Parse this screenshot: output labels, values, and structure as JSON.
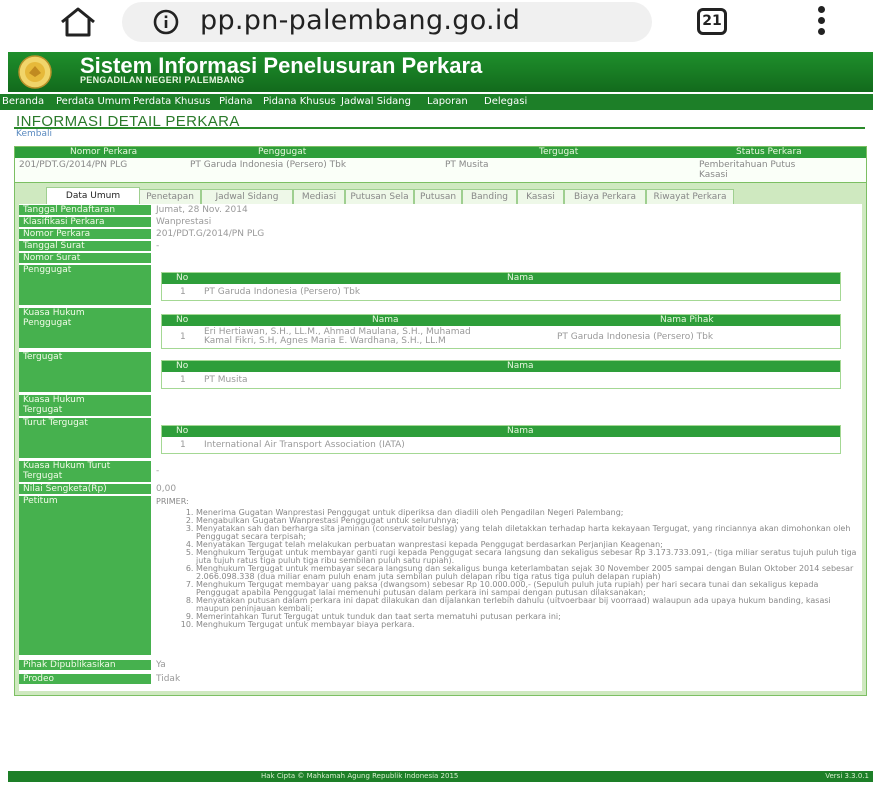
{
  "browser": {
    "url": "pp.pn-palembang.go.id",
    "tabs_count": "21"
  },
  "site": {
    "title": "Sistem Informasi Penelusuran Perkara",
    "subtitle": "PENGADILAN NEGERI PALEMBANG"
  },
  "nav": [
    "Beranda",
    "Perdata Umum",
    "Perdata Khusus",
    "Pidana",
    "Pidana Khusus",
    "Jadwal Sidang",
    "Laporan",
    "Delegasi"
  ],
  "page": {
    "title": "INFORMASI DETAIL PERKARA",
    "back": "Kembali"
  },
  "summary": {
    "headers": [
      "Nomor Perkara",
      "Penggugat",
      "Tergugat",
      "Status Perkara"
    ],
    "row": [
      "201/PDT.G/2014/PN PLG",
      "PT Garuda Indonesia (Persero) Tbk",
      "PT Musita",
      "Pemberitahuan Putus",
      "Kasasi"
    ]
  },
  "tabs": [
    "Data Umum",
    "Penetapan",
    "Jadwal Sidang",
    "Mediasi",
    "Putusan Sela",
    "Putusan",
    "Banding",
    "Kasasi",
    "Biaya Perkara",
    "Riwayat Perkara"
  ],
  "fields": {
    "tanggal_pendaftaran": {
      "label": "Tanggal Pendaftaran",
      "value": "Jumat, 28 Nov. 2014"
    },
    "klasifikasi": {
      "label": "Klasifikasi Perkara",
      "value": "Wanprestasi"
    },
    "nomor_perkara": {
      "label": "Nomor Perkara",
      "value": "201/PDT.G/2014/PN PLG"
    },
    "tanggal_surat": {
      "label": "Tanggal Surat",
      "value": "-"
    },
    "nomor_surat": {
      "label": "Nomor Surat",
      "value": ""
    },
    "penggugat": {
      "label": "Penggugat",
      "col_no": "No",
      "col_nama": "Nama",
      "no": "1",
      "nama": "PT Garuda Indonesia (Persero) Tbk"
    },
    "kuasa_penggugat": {
      "label1": "Kuasa Hukum",
      "label2": "Penggugat",
      "col_no": "No",
      "col_nama": "Nama",
      "col_pihak": "Nama Pihak",
      "no": "1",
      "nama1": "Eri Hertiawan, S.H., LL.M., Ahmad Maulana, S.H., Muhamad",
      "nama2": "Kamal Fikri, S.H, Agnes Maria E. Wardhana, S.H., LL.M",
      "pihak": "PT Garuda Indonesia (Persero) Tbk"
    },
    "tergugat": {
      "label": "Tergugat",
      "col_no": "No",
      "col_nama": "Nama",
      "no": "1",
      "nama": "PT Musita"
    },
    "kuasa_tergugat": {
      "label1": "Kuasa Hukum",
      "label2": "Tergugat"
    },
    "turut_tergugat": {
      "label": "Turut Tergugat",
      "col_no": "No",
      "col_nama": "Nama",
      "no": "1",
      "nama": "International Air Transport Association (IATA)"
    },
    "kuasa_turut": {
      "label1": "Kuasa Hukum Turut",
      "label2": "Tergugat",
      "value": "-"
    },
    "nilai_sengketa": {
      "label": "Nilai Sengketa(Rp)",
      "value": "0,00"
    },
    "petitum": {
      "label": "Petitum",
      "heading": "PRIMER:"
    },
    "dipublikasikan": {
      "label": "Pihak Dipublikasikan",
      "value": "Ya"
    },
    "prodeo": {
      "label": "Prodeo",
      "value": "Tidak"
    }
  },
  "petitum_items": [
    "Menerima Gugatan Wanprestasi Penggugat untuk diperiksa dan diadili oleh Pengadilan Negeri Palembang;",
    "Mengabulkan Gugatan Wanprestasi Penggugat untuk seluruhnya;",
    "Menyatakan sah dan berharga sita jaminan (conservatoir beslag) yang telah diletakkan terhadap harta kekayaan Tergugat, yang rincian­nya akan dimohonkan oleh Penggugat secara terpisah;",
    "Menyatakan Tergugat telah melakukan perbuatan wanprestasi kepada Penggugat berdasarkan Perjanjian Keagenan;",
    "Menghukum Tergugat untuk membayar ganti rugi kepada Penggugat secara langsung dan sekaligus sebesar Rp 3.173.733.091,- (tiga miliar seratus tujuh puluh tiga juta tujuh ratus tiga puluh tiga ribu sembilan puluh satu rupiah).",
    "Menghukum Tergugat untuk membayar secara langsung dan sekaligus bunga keterlambatan sejak 30 November 2005 sampai dengan Bulan Oktober 2014 sebesar 2.066.098.338 (dua miliar enam puluh enam juta sembilan puluh delapan ribu tiga ratus tiga puluh delapan rupiah)",
    "Menghukum Tergugat membayar uang paksa (dwangsom) sebesar Rp 10.000.000,- (Sepuluh puluh juta rupiah) per hari secara tunai dan sekaligus kepada Penggugat apabila Penggugat lalai memenuhi putusan dalam perkara ini sampai dengan putusan dilaksanakan;",
    "Menyatakan putusan dalam perkara ini dapat dilakukan dan dijalankan terlebih dahulu (uitvoerbaar bij voorraad) walaupun ada upaya hukum banding, kasasi maupun peninjauan kembali;",
    "Memerintahkan Turut Tergugat untuk tunduk dan taat serta mematuhi putusan perkara ini;",
    "Menghukum Tergugat untuk membayar biaya perkara."
  ],
  "footer": {
    "copyright": "Hak Cipta © Mahkamah Agung Republik Indonesia 2015",
    "version": "Versi 3.3.0.1"
  }
}
